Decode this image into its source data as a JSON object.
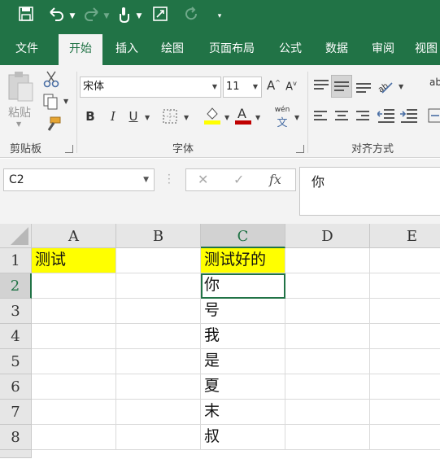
{
  "qat": {
    "icons": [
      "save-icon",
      "undo-icon",
      "redo-icon",
      "touch-mode-icon",
      "form-icon",
      "repeat-icon",
      "customize-icon"
    ]
  },
  "tabs": [
    {
      "label": "文件",
      "active": false
    },
    {
      "label": "开始",
      "active": true
    },
    {
      "label": "插入",
      "active": false
    },
    {
      "label": "绘图",
      "active": false
    },
    {
      "label": "页面布局",
      "active": false
    },
    {
      "label": "公式",
      "active": false
    },
    {
      "label": "数据",
      "active": false
    },
    {
      "label": "审阅",
      "active": false
    },
    {
      "label": "视图",
      "active": false
    }
  ],
  "ribbon": {
    "clipboard": {
      "paste_label": "粘贴",
      "group_label": "剪贴板"
    },
    "font": {
      "font_name": "宋体",
      "font_size": "11",
      "bold": "B",
      "italic": "I",
      "underline": "U",
      "phonetic": "wén",
      "group_label": "字体"
    },
    "alignment": {
      "group_label": "对齐方式",
      "wrap_label": "ab"
    }
  },
  "formula_bar": {
    "name_box": "C2",
    "cancel": "✕",
    "enter": "✓",
    "fx": "fx",
    "content": "你"
  },
  "grid": {
    "columns": [
      "A",
      "B",
      "C",
      "D",
      "E"
    ],
    "rows": [
      {
        "num": "1",
        "A": "测试",
        "B": "",
        "C": "测试好的",
        "D": "",
        "E": ""
      },
      {
        "num": "2",
        "A": "",
        "B": "",
        "C": "你",
        "D": "",
        "E": ""
      },
      {
        "num": "3",
        "A": "",
        "B": "",
        "C": "号",
        "D": "",
        "E": ""
      },
      {
        "num": "4",
        "A": "",
        "B": "",
        "C": "我",
        "D": "",
        "E": ""
      },
      {
        "num": "5",
        "A": "",
        "B": "",
        "C": "是",
        "D": "",
        "E": ""
      },
      {
        "num": "6",
        "A": "",
        "B": "",
        "C": "夏",
        "D": "",
        "E": ""
      },
      {
        "num": "7",
        "A": "",
        "B": "",
        "C": "末",
        "D": "",
        "E": ""
      },
      {
        "num": "8",
        "A": "",
        "B": "",
        "C": "叔",
        "D": "",
        "E": ""
      }
    ],
    "highlight_color": "#ffff00",
    "selected_cell": "C2",
    "accent_color": "#217346"
  }
}
